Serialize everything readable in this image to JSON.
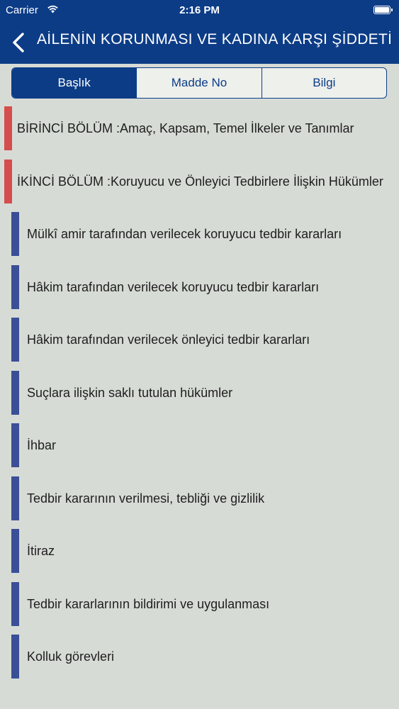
{
  "status_bar": {
    "carrier": "Carrier",
    "time": "2:16 PM",
    "wifi_icon": "wifi-icon",
    "battery_icon": "battery-icon"
  },
  "nav": {
    "back_icon": "chevron-left-icon",
    "title": "AİLENİN KORUNMASI VE KADINA KARŞI ŞİDDETİN"
  },
  "segments": [
    {
      "label": "Başlık",
      "selected": true
    },
    {
      "label": "Madde No",
      "selected": false
    },
    {
      "label": "Bilgi",
      "selected": false
    }
  ],
  "colors": {
    "header": "#0c3c86",
    "chapter_marker": "#d54d4d",
    "article_marker": "#3a4f95",
    "background": "#d7dbd6"
  },
  "list": [
    {
      "type": "chapter",
      "label": "BİRİNCİ BÖLÜM :Amaç, Kapsam, Temel İlkeler ve Tanımlar"
    },
    {
      "type": "chapter",
      "label": "İKİNCİ BÖLÜM :Koruyucu ve Önleyici Tedbirlere İlişkin Hükümler"
    },
    {
      "type": "article",
      "label": "Mülkî amir tarafından verilecek koruyucu tedbir kararları"
    },
    {
      "type": "article",
      "label": "Hâkim tarafından verilecek koruyucu tedbir kararları"
    },
    {
      "type": "article",
      "label": "Hâkim tarafından verilecek önleyici tedbir kararları"
    },
    {
      "type": "article",
      "label": "Suçlara ilişkin saklı tutulan hükümler"
    },
    {
      "type": "article",
      "label": "İhbar"
    },
    {
      "type": "article",
      "label": "Tedbir kararının verilmesi, tebliği ve gizlilik"
    },
    {
      "type": "article",
      "label": "İtiraz"
    },
    {
      "type": "article",
      "label": "Tedbir kararlarının bildirimi ve uygulanması"
    },
    {
      "type": "article",
      "label": "Kolluk görevleri"
    }
  ]
}
